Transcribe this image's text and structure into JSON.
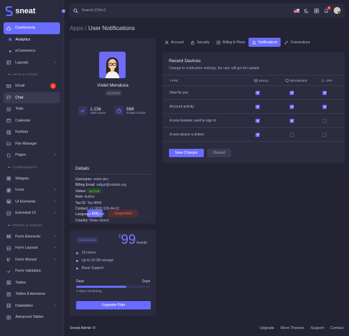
{
  "brand": {
    "name": "sneat"
  },
  "colors": {
    "accent": "#696cff",
    "bg": "#232333",
    "card": "#2b2c40",
    "danger": "#ff3e1d",
    "success": "#71dd37"
  },
  "sidebar": {
    "items": [
      {
        "label": "Dashboards",
        "icon": "home-icon",
        "active": true
      },
      {
        "label": "Analytics",
        "sub": true,
        "active": true
      },
      {
        "label": "eCommerce",
        "sub": true
      },
      {
        "label": "Layouts",
        "icon": "layout-icon",
        "chevron": true
      },
      {
        "section": "APPS & PAGES"
      },
      {
        "label": "Email",
        "icon": "mail-icon",
        "badge": "4"
      },
      {
        "label": "Chat",
        "icon": "chat-icon",
        "current": true
      },
      {
        "label": "Todo",
        "icon": "check-square-icon"
      },
      {
        "label": "Calendar",
        "icon": "calendar-icon"
      },
      {
        "label": "Kanban",
        "icon": "kanban-icon"
      },
      {
        "label": "File Manager",
        "icon": "folder-icon"
      },
      {
        "label": "Pages",
        "icon": "pages-icon",
        "chevron": true
      },
      {
        "section": "COMPONENTS"
      },
      {
        "label": "Widgets",
        "icon": "widgets-icon"
      },
      {
        "label": "Icons",
        "icon": "icons-icon",
        "chevron": true
      },
      {
        "label": "UI Elements",
        "icon": "ui-elements-icon",
        "chevron": true
      },
      {
        "label": "Extended UI",
        "icon": "extended-ui-icon",
        "chevron": true
      },
      {
        "section": "FORMS & TABLES"
      },
      {
        "label": "Form Elements",
        "icon": "form-elements-icon",
        "chevron": true
      },
      {
        "label": "Form Layouts",
        "icon": "form-layouts-icon",
        "chevron": true
      },
      {
        "label": "Form Wizard",
        "icon": "form-wizard-icon",
        "chevron": true
      },
      {
        "label": "Form Validation",
        "icon": "form-validation-icon"
      },
      {
        "label": "Tables",
        "icon": "table-icon"
      },
      {
        "label": "Tables Extensions",
        "icon": "table-ext-icon"
      },
      {
        "label": "Datatables",
        "icon": "datatables-icon",
        "chevron": true
      },
      {
        "label": "Advanced Tables",
        "icon": "advanced-tables-icon"
      }
    ]
  },
  "navbar": {
    "search_placeholder": "Search (Ctrl+/)",
    "notif_count": "4"
  },
  "breadcrumb": {
    "parent": "Apps /",
    "current": "User Notifications"
  },
  "profile": {
    "name": "Violet Mendoza",
    "role": "AUTHOR",
    "stats": [
      {
        "value": "1.23k",
        "label": "Task Done"
      },
      {
        "value": "568",
        "label": "Project Done"
      }
    ],
    "details_title": "Details",
    "details": [
      {
        "key": "Username:",
        "value": "violet.dev"
      },
      {
        "key": "Billing Email:",
        "value": "vafgot@vultukir.org"
      },
      {
        "key": "Status:",
        "value": "ACTIVE",
        "badge": true
      },
      {
        "key": "Role:",
        "value": "Author"
      },
      {
        "key": "Tax ID:",
        "value": "Tax-8894"
      },
      {
        "key": "Contact:",
        "value": "+1 (609) 933-44-22"
      },
      {
        "key": "Language:",
        "value": "English"
      },
      {
        "key": "Country:",
        "value": "Wake Island"
      }
    ],
    "edit_label": "Edit",
    "suspend_label": "Suspended"
  },
  "plan": {
    "badge": "STANDARD",
    "currency": "$",
    "price": "99",
    "period": "/month",
    "features": [
      "10 Users",
      "Up to 10 GB storage",
      "Basic Support"
    ],
    "days_label_left": "Days",
    "days_label_right": "Days",
    "progress": 0.68,
    "remaining": "4 days remaining",
    "upgrade_label": "Upgrade Plan"
  },
  "tabs": [
    {
      "label": "Account",
      "icon": "user-icon"
    },
    {
      "label": "Security",
      "icon": "lock-icon"
    },
    {
      "label": "Billing & Plans",
      "icon": "bill-icon"
    },
    {
      "label": "Notifications",
      "icon": "bell-icon",
      "active": true
    },
    {
      "label": "Connections",
      "icon": "link-icon"
    }
  ],
  "notifications": {
    "title": "Recent Devices",
    "subtitle": "Change to notification settings, the user will get the update",
    "columns": {
      "type": "TYPE",
      "email": "EMAIL",
      "browser": "BROWSER",
      "app": "APP"
    },
    "rows": [
      {
        "type": "New for you",
        "email": true,
        "browser": true,
        "app": true
      },
      {
        "type": "Account activity",
        "email": true,
        "browser": true,
        "app": true
      },
      {
        "type": "A new browser used to sign in",
        "email": true,
        "browser": true,
        "app": false
      },
      {
        "type": "A new device is linked",
        "email": true,
        "browser": false,
        "app": false
      }
    ],
    "save_label": "Save Changes",
    "discard_label": "Discard"
  },
  "footer": {
    "brand": "Sneat Admin ©",
    "links": [
      "Upgrade",
      "More Themes",
      "Support",
      "Contact"
    ]
  }
}
